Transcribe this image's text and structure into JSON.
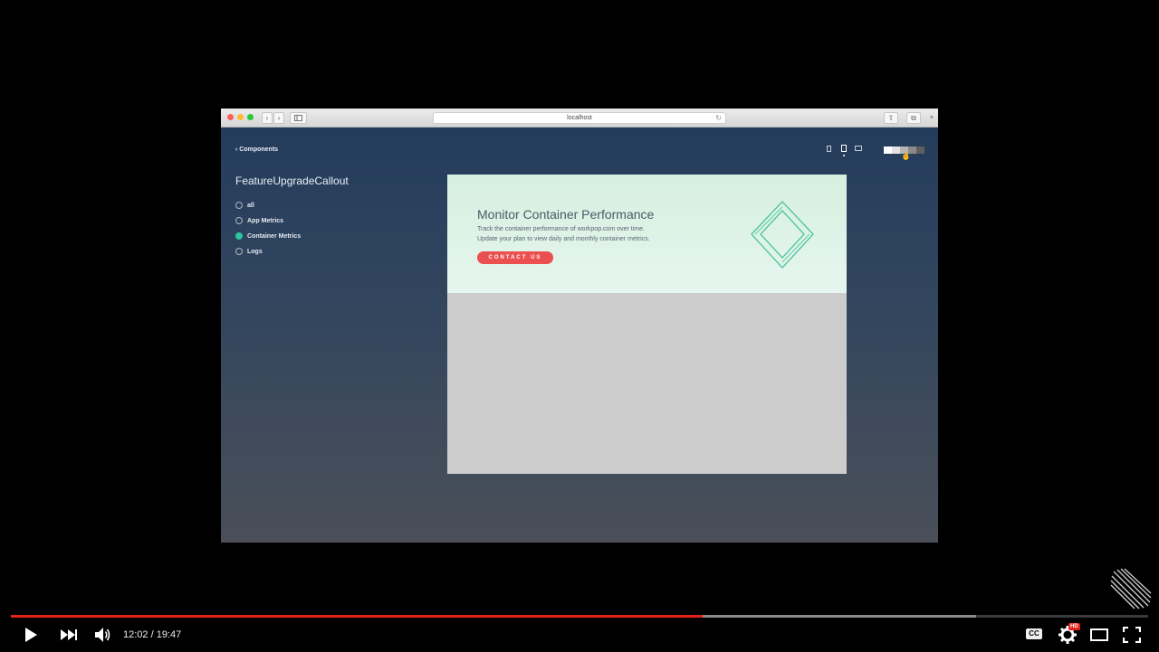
{
  "browser": {
    "url": "localhost"
  },
  "app": {
    "back_link": "Components",
    "component_title": "FeatureUpgradeCallout",
    "options": [
      {
        "label": "all",
        "selected": false
      },
      {
        "label": "App Metrics",
        "selected": false
      },
      {
        "label": "Container Metrics",
        "selected": true
      },
      {
        "label": "Logs",
        "selected": false
      }
    ],
    "swatch_colors": [
      "#ffffff",
      "#e2e2e2",
      "#b4b4b4",
      "#8a8a8a",
      "#5e5e5e"
    ]
  },
  "callout": {
    "title": "Monitor Container Performance",
    "line1": "Track the container performance of workpop.com over time.",
    "line2": "Update your plan to view daily and monthly container metrics.",
    "button_label": "CONTACT US",
    "accent_color": "#ec4f4f",
    "diamond_color": "#3bbf9a"
  },
  "player": {
    "time_display": "12:02 / 19:47",
    "progress_fraction": 0.608,
    "buffered_fraction": 0.849,
    "hd_label": "HD",
    "cc_label": "CC",
    "accent_color": "#e62117"
  }
}
